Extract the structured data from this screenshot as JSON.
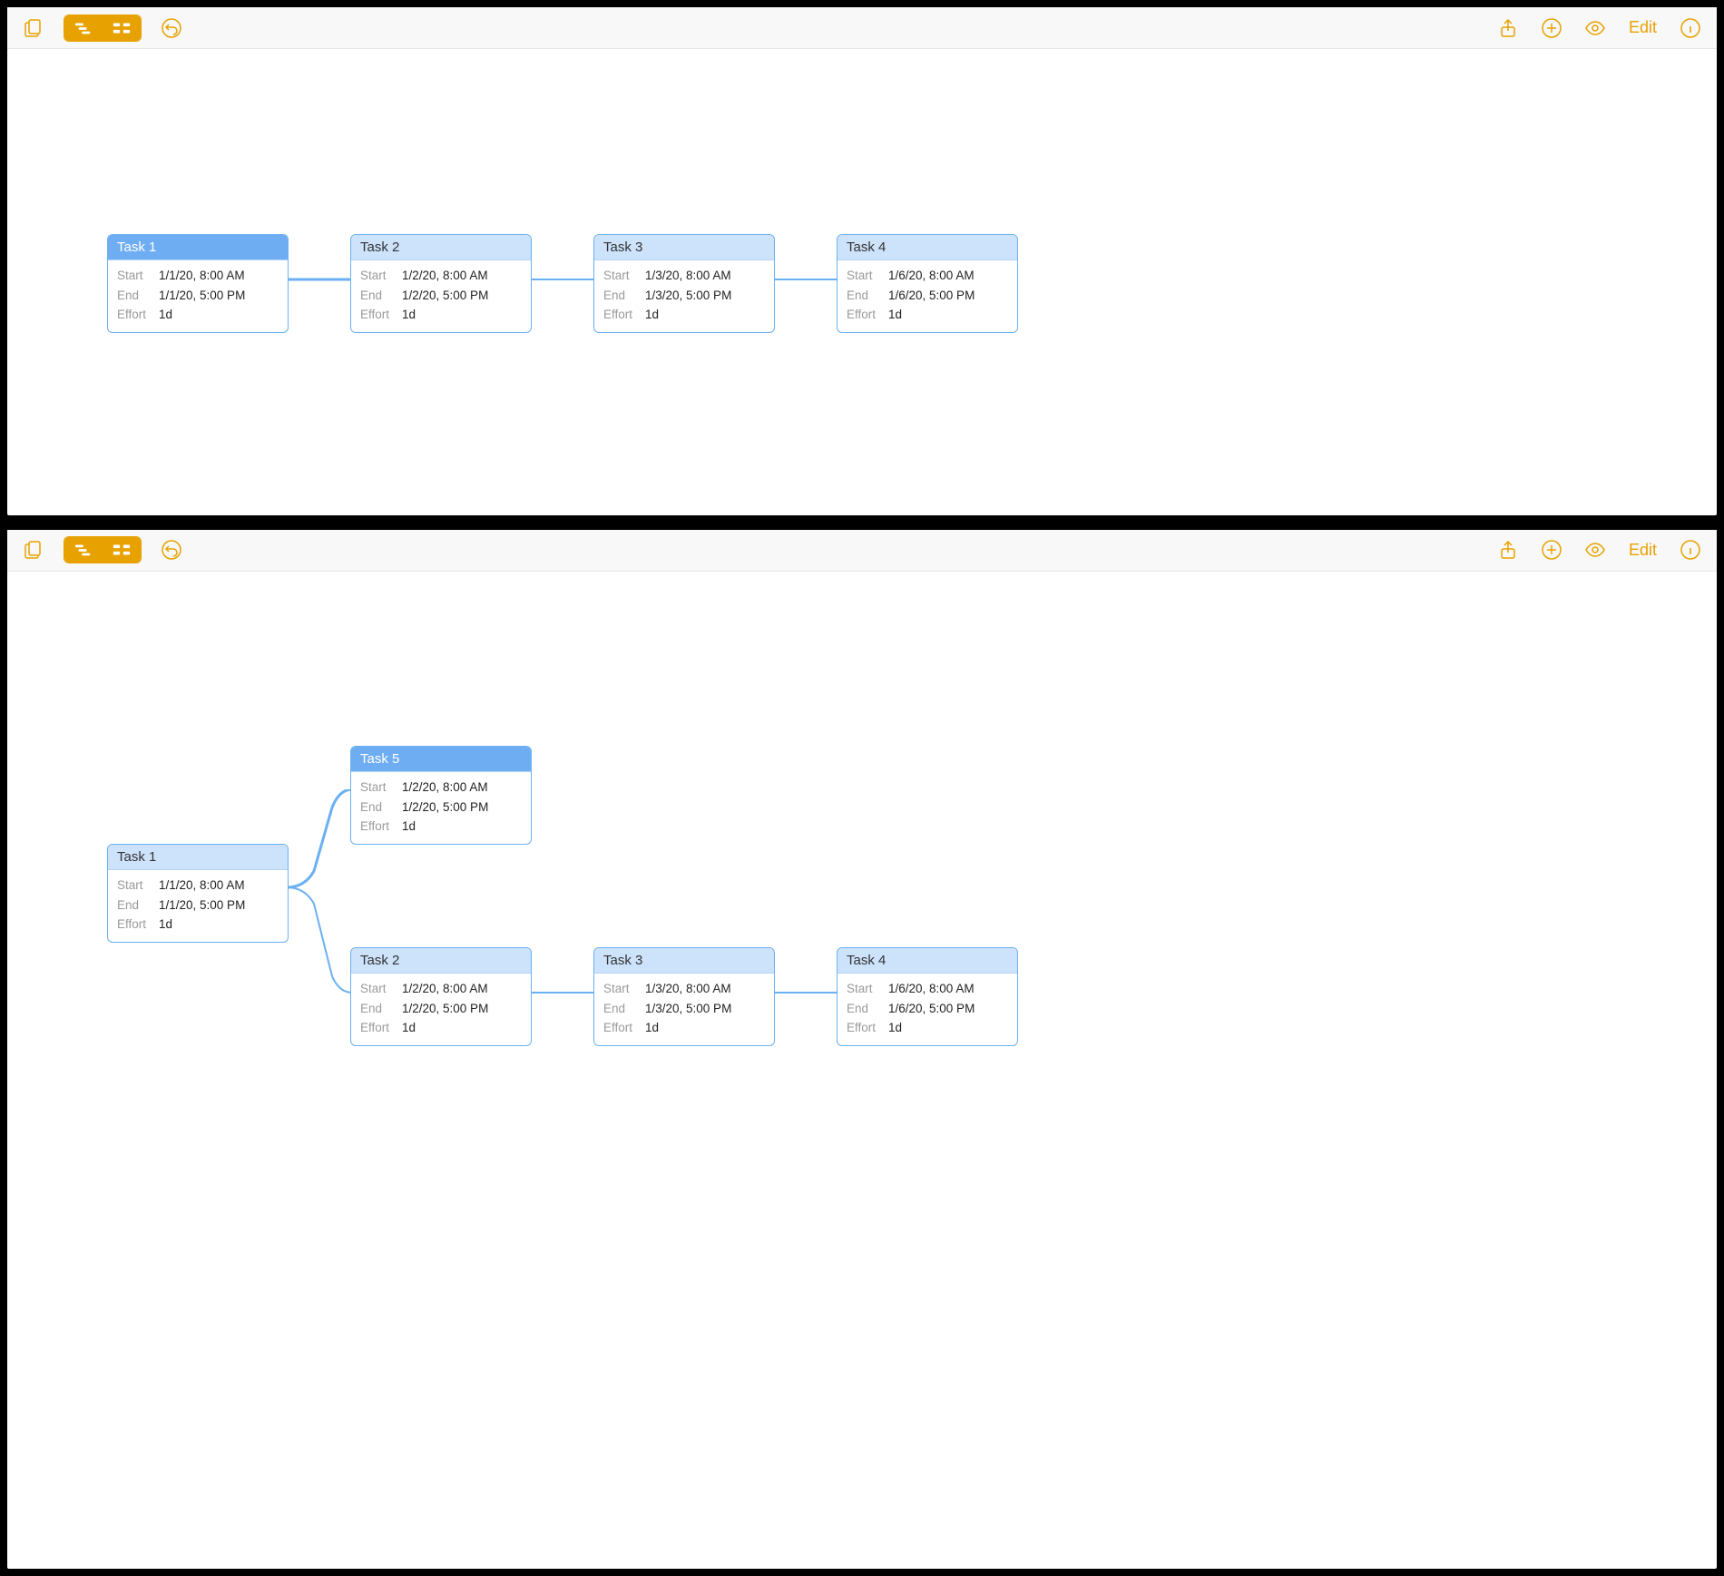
{
  "toolbar": {
    "edit_label": "Edit"
  },
  "field_labels": {
    "start": "Start",
    "end": "End",
    "effort": "Effort"
  },
  "panes": [
    {
      "tasks": [
        {
          "id": "t1",
          "title": "Task 1",
          "start": "1/1/20, 8:00 AM",
          "end": "1/1/20, 5:00 PM",
          "effort": "1d",
          "selected": true
        },
        {
          "id": "t2",
          "title": "Task 2",
          "start": "1/2/20, 8:00 AM",
          "end": "1/2/20, 5:00 PM",
          "effort": "1d",
          "selected": false
        },
        {
          "id": "t3",
          "title": "Task 3",
          "start": "1/3/20, 8:00 AM",
          "end": "1/3/20, 5:00 PM",
          "effort": "1d",
          "selected": false
        },
        {
          "id": "t4",
          "title": "Task 4",
          "start": "1/6/20, 8:00 AM",
          "end": "1/6/20, 5:00 PM",
          "effort": "1d",
          "selected": false
        }
      ]
    },
    {
      "tasks": [
        {
          "id": "t1",
          "title": "Task 1",
          "start": "1/1/20, 8:00 AM",
          "end": "1/1/20, 5:00 PM",
          "effort": "1d",
          "selected": false
        },
        {
          "id": "t5",
          "title": "Task 5",
          "start": "1/2/20, 8:00 AM",
          "end": "1/2/20, 5:00 PM",
          "effort": "1d",
          "selected": true
        },
        {
          "id": "t2",
          "title": "Task 2",
          "start": "1/2/20, 8:00 AM",
          "end": "1/2/20, 5:00 PM",
          "effort": "1d",
          "selected": false
        },
        {
          "id": "t3",
          "title": "Task 3",
          "start": "1/3/20, 8:00 AM",
          "end": "1/3/20, 5:00 PM",
          "effort": "1d",
          "selected": false
        },
        {
          "id": "t4",
          "title": "Task 4",
          "start": "1/6/20, 8:00 AM",
          "end": "1/6/20, 5:00 PM",
          "effort": "1d",
          "selected": false
        }
      ]
    }
  ]
}
